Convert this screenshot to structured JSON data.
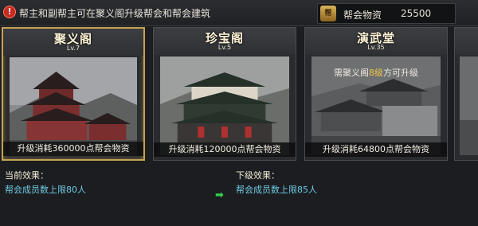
{
  "notice": {
    "icon": "exclamation-icon",
    "text": "帮主和副帮主可在聚义阁升级帮会和帮会建筑"
  },
  "resource": {
    "icon_text": "帮",
    "label": "帮会物资",
    "value": "25500"
  },
  "buildings": [
    {
      "name": "聚义阁",
      "level": "Lv.7",
      "cost": "升级消耗360000点帮会物资"
    },
    {
      "name": "珍宝阁",
      "level": "Lv.5",
      "cost": "升级消耗120000点帮会物资"
    },
    {
      "name": "演武堂",
      "level": "Lv.35",
      "cost": "升级消耗64800点帮会物资",
      "lock_prefix": "需聚义阁",
      "lock_level": "8级",
      "lock_suffix": "方可升级"
    }
  ],
  "effects": {
    "current_title": "当前效果：",
    "current_text": "帮会成员数上限80人",
    "next_title": "下级效果：",
    "next_text": "帮会成员数上限85人"
  },
  "colors": {
    "selected_border": "#c7a251",
    "effect_text": "#6fcbe6",
    "lock_highlight": "#f2c84b",
    "arrow": "#32d04a"
  }
}
